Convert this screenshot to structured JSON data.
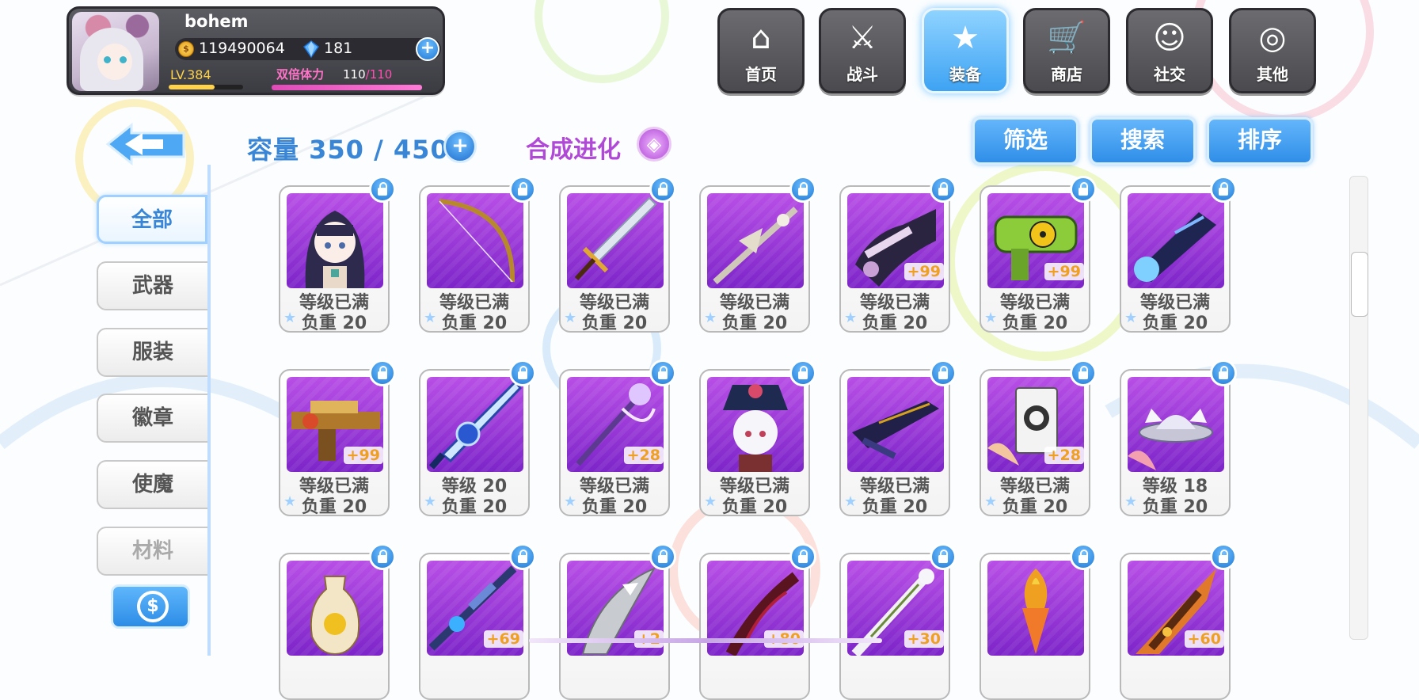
{
  "profile": {
    "name": "bohem",
    "gold": "119490064",
    "gems": "181",
    "level": "LV.384",
    "level_progress": 0.62,
    "stamina_label": "双倍体力",
    "stamina_current": "110",
    "stamina_max": "/110",
    "stamina_progress": 1.0,
    "add_label": "+"
  },
  "nav": [
    {
      "label": "首页",
      "icon": "home-icon",
      "glyph": "⌂",
      "active": false
    },
    {
      "label": "战斗",
      "icon": "battle-icon",
      "glyph": "⚔",
      "active": false
    },
    {
      "label": "装备",
      "icon": "equipment-icon",
      "glyph": "★",
      "active": true
    },
    {
      "label": "商店",
      "icon": "shop-icon",
      "glyph": "🛒",
      "active": false
    },
    {
      "label": "社交",
      "icon": "social-icon",
      "glyph": "☺",
      "active": false
    },
    {
      "label": "其他",
      "icon": "other-icon",
      "glyph": "◎",
      "active": false
    }
  ],
  "capacity": {
    "label": "容量 350 / 450",
    "plus": "+"
  },
  "synthesis": {
    "label": "合成进化",
    "glyph": "◈"
  },
  "actions": {
    "filter": "筛选",
    "search": "搜索",
    "sort": "排序"
  },
  "categories": [
    {
      "label": "全部",
      "active": true
    },
    {
      "label": "武器",
      "active": false
    },
    {
      "label": "服装",
      "active": false
    },
    {
      "label": "徽章",
      "active": false
    },
    {
      "label": "使魔",
      "active": false
    },
    {
      "label": "材料",
      "active": false
    }
  ],
  "coin_button": "$",
  "items": [
    {
      "kind": "girl",
      "line1": "等级已满",
      "line2": "负重 20",
      "plus": ""
    },
    {
      "kind": "bow",
      "line1": "等级已满",
      "line2": "负重 20",
      "plus": ""
    },
    {
      "kind": "sword",
      "line1": "等级已满",
      "line2": "负重 20",
      "plus": ""
    },
    {
      "kind": "lance",
      "line1": "等级已满",
      "line2": "负重 20",
      "plus": ""
    },
    {
      "kind": "gauntlet",
      "line1": "等级已满",
      "line2": "负重 20",
      "plus": "+99"
    },
    {
      "kind": "nuke-gun",
      "line1": "等级已满",
      "line2": "负重 20",
      "plus": "+99"
    },
    {
      "kind": "dark-cannon",
      "line1": "等级已满",
      "line2": "负重 20",
      "plus": ""
    },
    {
      "kind": "gold-gun",
      "line1": "等级已满",
      "line2": "负重 20",
      "plus": "+99"
    },
    {
      "kind": "blue-blade",
      "line1": "等级 20",
      "line2": "负重 20",
      "plus": ""
    },
    {
      "kind": "purple-staff",
      "line1": "等级已满",
      "line2": "负重 20",
      "plus": "+28"
    },
    {
      "kind": "girl-hat",
      "line1": "等级已满",
      "line2": "负重 20",
      "plus": ""
    },
    {
      "kind": "dark-rifle",
      "line1": "等级已满",
      "line2": "负重 20",
      "plus": ""
    },
    {
      "kind": "card-badge",
      "line1": "等级已满",
      "line2": "负重 20",
      "plus": "+28"
    },
    {
      "kind": "ufo-cat",
      "line1": "等级 18",
      "line2": "负重 20",
      "plus": ""
    },
    {
      "kind": "vase",
      "line1": "",
      "line2": "",
      "plus": ""
    },
    {
      "kind": "sniper",
      "line1": "",
      "line2": "",
      "plus": "+69"
    },
    {
      "kind": "shark-blade",
      "line1": "",
      "line2": "",
      "plus": "+2"
    },
    {
      "kind": "red-scythe",
      "line1": "",
      "line2": "",
      "plus": "+80"
    },
    {
      "kind": "white-blade",
      "line1": "",
      "line2": "",
      "plus": "+30"
    },
    {
      "kind": "carrot",
      "line1": "",
      "line2": "",
      "plus": ""
    },
    {
      "kind": "flame-sword",
      "line1": "",
      "line2": "",
      "plus": "+60"
    }
  ]
}
